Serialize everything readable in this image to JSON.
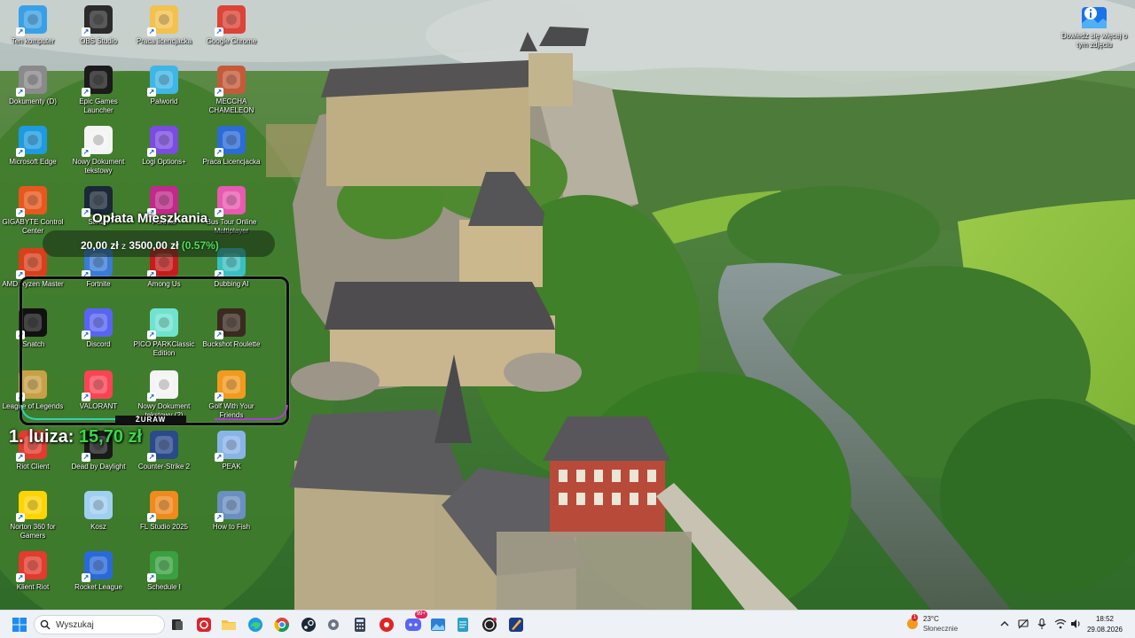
{
  "desktop_icons": [
    {
      "label": "Ten komputer",
      "icon": "monitor-icon",
      "color": "#3aa0e6"
    },
    {
      "label": "OBS Studio",
      "icon": "obs-icon",
      "color": "#2b2b2b"
    },
    {
      "label": "Praca licencjacka",
      "icon": "folder-icon",
      "color": "#f2c14e"
    },
    {
      "label": "Google Chrome",
      "icon": "chrome-icon",
      "color": "#db4437"
    },
    {
      "label": "Dokumenty (D)",
      "icon": "drive-icon",
      "color": "#8a8a8a"
    },
    {
      "label": "Epic Games Launcher",
      "icon": "epic-games-icon",
      "color": "#1b1b1b"
    },
    {
      "label": "Palworld",
      "icon": "palworld-icon",
      "color": "#3fb6e6"
    },
    {
      "label": "MECCHA CHAMELEON",
      "icon": "game-icon",
      "color": "#c45a3a"
    },
    {
      "label": "Microsoft Edge",
      "icon": "edge-icon",
      "color": "#1e9be0"
    },
    {
      "label": "Nowy Dokument tekstowy",
      "icon": "text-document-icon",
      "color": "#f4f4f4"
    },
    {
      "label": "Logi Options+",
      "icon": "logi-icon",
      "color": "#7a4ce0"
    },
    {
      "label": "Praca Licencjacka",
      "icon": "word-icon",
      "color": "#2b6cd6"
    },
    {
      "label": "GIGABYTE Control Center",
      "icon": "gigabyte-icon",
      "color": "#e8581c"
    },
    {
      "label": "Steam",
      "icon": "steam-icon",
      "color": "#1b2838"
    },
    {
      "label": "Fortnite",
      "icon": "fortnite-icon",
      "color": "#c02a8a"
    },
    {
      "label": "Bus Tour Online Multiplayer",
      "icon": "game-icon",
      "color": "#e85ab0"
    },
    {
      "label": "AMD Ryzen Master",
      "icon": "amd-icon",
      "color": "#d8401c"
    },
    {
      "label": "Fortnite",
      "icon": "fortnite-icon",
      "color": "#3a7bd5"
    },
    {
      "label": "Among Us",
      "icon": "among-us-icon",
      "color": "#c41d1d"
    },
    {
      "label": "Dubbing AI",
      "icon": "dubbing-ai-icon",
      "color": "#3ac0c0"
    },
    {
      "label": "iSnatch",
      "icon": "isnatch-icon",
      "color": "#111111"
    },
    {
      "label": "Discord",
      "icon": "discord-icon",
      "color": "#5865f2"
    },
    {
      "label": "PICO PARKClassic Edition",
      "icon": "pico-park-icon",
      "color": "#6fe3d0"
    },
    {
      "label": "Buckshot Roulette",
      "icon": "buckshot-icon",
      "color": "#3a2a20"
    },
    {
      "label": "League of Legends",
      "icon": "league-icon",
      "color": "#c8a045"
    },
    {
      "label": "VALORANT",
      "icon": "valorant-icon",
      "color": "#fa4454"
    },
    {
      "label": "Nowy Dokument tekstowy (2)",
      "icon": "text-document-icon",
      "color": "#f4f4f4"
    },
    {
      "label": "Golf With Your Friends",
      "icon": "golf-icon",
      "color": "#f29a1e"
    },
    {
      "label": "Riot Client",
      "icon": "riot-icon",
      "color": "#e33b2e"
    },
    {
      "label": "Dead by Daylight",
      "icon": "dbd-icon",
      "color": "#1a1a1a"
    },
    {
      "label": "Counter-Strike 2",
      "icon": "cs2-icon",
      "color": "#2a4a8a"
    },
    {
      "label": "PEAK",
      "icon": "peak-icon",
      "color": "#8ab4e8"
    },
    {
      "label": "Norton 360 for Gamers",
      "icon": "norton-icon",
      "color": "#ffd400"
    },
    {
      "label": "Kosz",
      "icon": "recycle-bin-icon",
      "color": "#9fd0f0"
    },
    {
      "label": "FL Studio 2025",
      "icon": "fl-studio-icon",
      "color": "#f08a1c"
    },
    {
      "label": "How to Fish",
      "icon": "fish-game-icon",
      "color": "#6a8fc0"
    },
    {
      "label": "Klient Riot",
      "icon": "riot-icon",
      "color": "#e33b2e"
    },
    {
      "label": "Rocket League",
      "icon": "rocket-league-icon",
      "color": "#2a6ad8"
    },
    {
      "label": "Schedule I",
      "icon": "schedule-icon",
      "color": "#3aa040"
    }
  ],
  "rent_widget": {
    "title": "Opłata Mieszkania",
    "current": "20,00 zł",
    "separator": "z",
    "target": "3500,00 zł",
    "percent": "(0.57%)",
    "progress_fraction": 0.0057
  },
  "frame_label": "ŻURAW",
  "donor": {
    "name": "1. luiza:",
    "amount": "15,70 zł"
  },
  "learn_more": {
    "label": "Dowiedz się więcej o tym zdjęciu",
    "icon": "info-picture-icon"
  },
  "taskbar": {
    "search_placeholder": "Wyszukaj",
    "apps": [
      {
        "icon": "windows-start-icon"
      },
      {
        "icon": "task-view-icon"
      },
      {
        "icon": "app-red-icon"
      },
      {
        "icon": "file-explorer-icon"
      },
      {
        "icon": "edge-icon"
      },
      {
        "icon": "chrome-icon"
      },
      {
        "icon": "steam-icon"
      },
      {
        "icon": "settings-icon"
      },
      {
        "icon": "calculator-icon"
      },
      {
        "icon": "app-red-round-icon"
      },
      {
        "icon": "discord-icon"
      },
      {
        "icon": "photos-icon"
      },
      {
        "icon": "notepad-icon"
      },
      {
        "icon": "obs-icon"
      },
      {
        "icon": "app-paint-icon"
      }
    ],
    "discord_badge": "99+",
    "weather": {
      "temp": "23°C",
      "condition": "Słonecznie",
      "badge": "1"
    },
    "tray": [
      "chevron-up-icon",
      "no-network-icon",
      "microphone-icon",
      "wifi-icon",
      "speaker-icon"
    ],
    "time": "18:52",
    "date": "29.08.2026"
  }
}
